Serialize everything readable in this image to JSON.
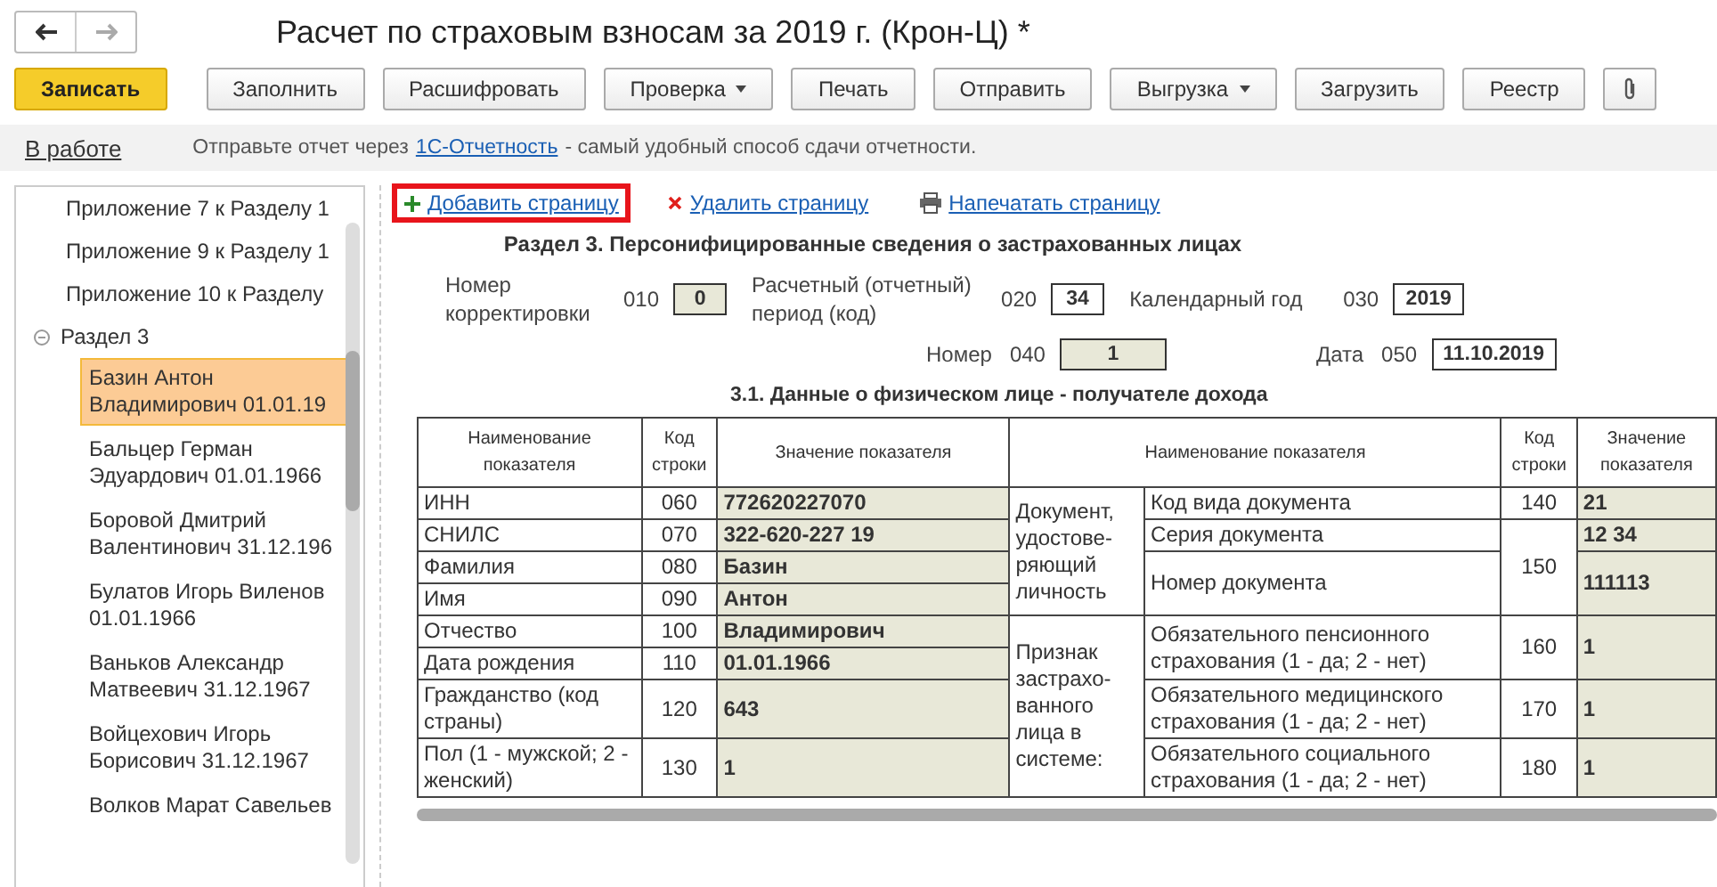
{
  "window": {
    "title": "Расчет по страховым взносам за 2019 г. (Крон-Ц) *"
  },
  "toolbar": [
    {
      "label": "Записать",
      "kind": "primary"
    },
    {
      "label": "Заполнить",
      "kind": "button"
    },
    {
      "label": "Расшифровать",
      "kind": "button"
    },
    {
      "label": "Проверка",
      "kind": "dropdown"
    },
    {
      "label": "Печать",
      "kind": "button"
    },
    {
      "label": "Отправить",
      "kind": "button"
    },
    {
      "label": "Выгрузка",
      "kind": "dropdown"
    },
    {
      "label": "Загрузить",
      "kind": "button"
    },
    {
      "label": "Реестр",
      "kind": "button"
    },
    {
      "kind": "attach"
    }
  ],
  "status_bar": {
    "state": "В работе",
    "message_before": "Отправьте отчет через",
    "link": "1С-Отчетность",
    "message_after": "- самый удобный способ сдачи отчетности."
  },
  "sidebar": {
    "items": [
      {
        "label": "Приложение 7 к Разделу 1",
        "selected": false
      },
      {
        "label": "Приложение 9 к Разделу 1",
        "selected": false
      },
      {
        "label": "Приложение 10 к Разделу",
        "selected": false
      },
      {
        "label": "Раздел 3",
        "selected": false,
        "expanded": true,
        "children": [
          {
            "label": "Базин Антон Владимирович 01.01.19",
            "selected": true
          },
          {
            "label": "Бальцер Герман Эдуардович 01.01.1966",
            "selected": false
          },
          {
            "label": "Боровой Дмитрий Валентинович 31.12.196",
            "selected": false
          },
          {
            "label": "Булатов Игорь Виленов 01.01.1966",
            "selected": false
          },
          {
            "label": "Ваньков Александр Матвеевич 31.12.1967",
            "selected": false
          },
          {
            "label": "Войцехович Игорь Борисович 31.12.1967",
            "selected": false
          },
          {
            "label": "Волков Марат Савельев",
            "selected": false
          }
        ]
      }
    ]
  },
  "page_actions": [
    {
      "label": "Добавить страницу",
      "kind": "add",
      "highlighted": true
    },
    {
      "label": "Удалить страницу",
      "kind": "delete",
      "highlighted": false
    },
    {
      "label": "Напечатать страницу",
      "kind": "print",
      "highlighted": false
    }
  ],
  "section_title": "Раздел 3. Персонифицированные сведения о застрахованных лицах",
  "fields_row_1": [
    {
      "label": "Номер корректировки",
      "code": "010",
      "value": "0",
      "readonly": true
    },
    {
      "label": "Расчетный (отчетный) период (код)",
      "code": "020",
      "value": "34",
      "readonly": false
    },
    {
      "label": "Календарный год",
      "code": "030",
      "value": "2019",
      "readonly": false
    }
  ],
  "fields_row_2": [
    {
      "label": "Номер",
      "code": "040",
      "value": "1",
      "readonly": true
    },
    {
      "label": "Дата",
      "code": "050",
      "value": "11.10.2019",
      "readonly": false
    }
  ],
  "subsection_title": "3.1. Данные о физическом лице - получателе дохода",
  "table": {
    "columns_left": [
      "Наименование показателя",
      "Код строки",
      "Значение показателя"
    ],
    "columns_right": [
      "Наименование показателя",
      "Код строки",
      "Значение показателя"
    ],
    "rows_left": [
      {
        "name": "ИНН",
        "code": "060",
        "value": "772620227070"
      },
      {
        "name": "СНИЛС",
        "code": "070",
        "value": "322-620-227 19"
      },
      {
        "name": "Фамилия",
        "code": "080",
        "value": "Базин"
      },
      {
        "name": "Имя",
        "code": "090",
        "value": "Антон"
      },
      {
        "name": "Отчество",
        "code": "100",
        "value": "Владимирович"
      },
      {
        "name": "Дата рождения",
        "code": "110",
        "value": "01.01.1966"
      },
      {
        "name": "Гражданство (код страны)",
        "code": "120",
        "value": "643"
      },
      {
        "name": "Пол (1 - мужской; 2 - женский)",
        "code": "130",
        "value": "1"
      }
    ],
    "groups_right": [
      {
        "label": "Документ, удостове-ряющий личность",
        "items": [
          {
            "name": "Код вида документа",
            "code": "140",
            "value": "21"
          },
          {
            "name": "Серия документа",
            "code": "150",
            "value": "12 34"
          },
          {
            "name": "Номер документа",
            "value": "111113"
          }
        ]
      },
      {
        "label": "Признак застрахо-ванного лица в системе:",
        "items": [
          {
            "name": "Обязательного пенсионного страхования (1 - да; 2 - нет)",
            "code": "160",
            "value": "1"
          },
          {
            "name": "Обязательного медицинского страхования (1 - да; 2 - нет)",
            "code": "170",
            "value": "1"
          },
          {
            "name": "Обязательного социального страхования (1 - да; 2 - нет)",
            "code": "180",
            "value": "1"
          }
        ]
      }
    ]
  }
}
